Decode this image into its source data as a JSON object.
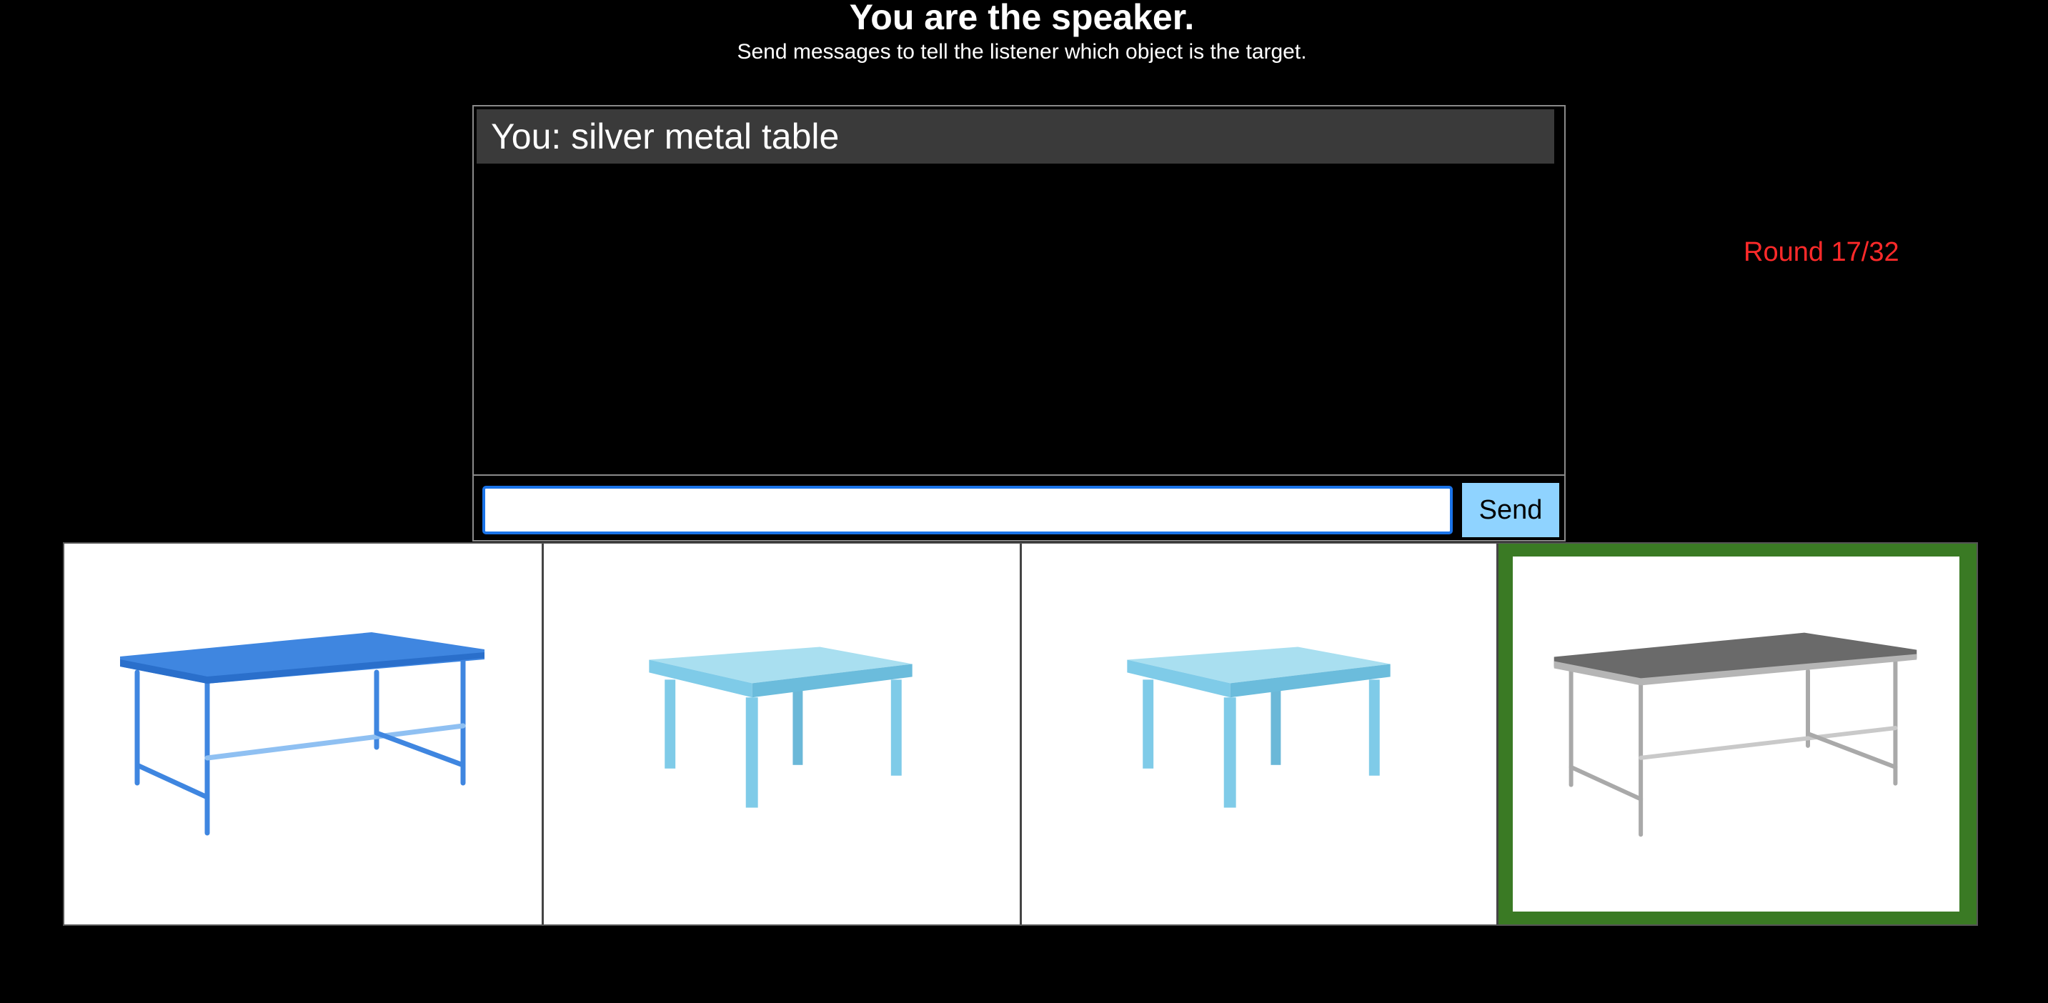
{
  "header": {
    "title": "You are the speaker.",
    "subtitle": "Send messages to tell the listener which object is the target."
  },
  "chat": {
    "messages": [
      {
        "text": "You: silver metal table"
      }
    ]
  },
  "input": {
    "value": "",
    "placeholder": "",
    "send_label": "Send"
  },
  "round": {
    "label": "Round 17/32"
  },
  "objects": [
    {
      "name": "blue metal rectangular table",
      "color": "#3f86e0",
      "target": false
    },
    {
      "name": "light blue wooden square table",
      "color": "#7fcbe8",
      "target": false
    },
    {
      "name": "light blue wooden square table",
      "color": "#7fcbe8",
      "target": false
    },
    {
      "name": "silver metal table",
      "color": "#9a9a9a",
      "target": true
    }
  ],
  "colors": {
    "target_border": "#3a7a24",
    "round_text": "#ff2a2a",
    "send_button": "#8fd3ff",
    "input_focus": "#1a73e8"
  }
}
